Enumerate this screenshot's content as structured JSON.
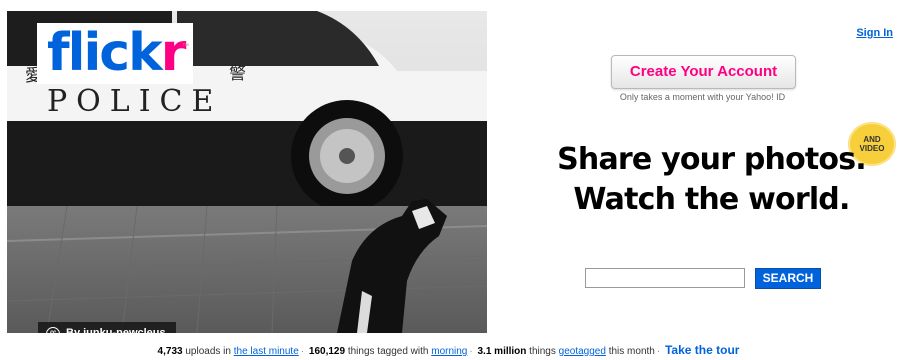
{
  "logo": {
    "text_main": "flick",
    "text_accent": "r",
    "trademark": "™"
  },
  "photo": {
    "description_chars": [
      "愛",
      "知",
      "県",
      "警"
    ],
    "car_text": "POLICE",
    "credit_icon": "cc",
    "credit_text": "By junku-newcleus"
  },
  "header": {
    "sign_in": "Sign In"
  },
  "signup": {
    "button_label": "Create Your Account",
    "subtext": "Only takes a moment with your Yahoo! ID"
  },
  "badge": {
    "line1": "AND",
    "line2": "VIDEO"
  },
  "tagline": {
    "line1": "Share your photos.",
    "line2": "Watch the world."
  },
  "search": {
    "value": "",
    "button_label": "SEARCH"
  },
  "stats": {
    "uploads_count": "4,733",
    "uploads_text": " uploads in ",
    "uploads_link": "the last minute",
    "tagged_count": "160,129",
    "tagged_text": " things tagged with ",
    "tagged_link": "morning",
    "geo_count": "3.1 million",
    "geo_text": " things ",
    "geo_link": "geotagged",
    "geo_suffix": " this month",
    "tour_link": "Take the tour"
  },
  "colors": {
    "brand_blue": "#0063dc",
    "brand_pink": "#ff0084",
    "badge_yellow": "#f7cf3a"
  }
}
